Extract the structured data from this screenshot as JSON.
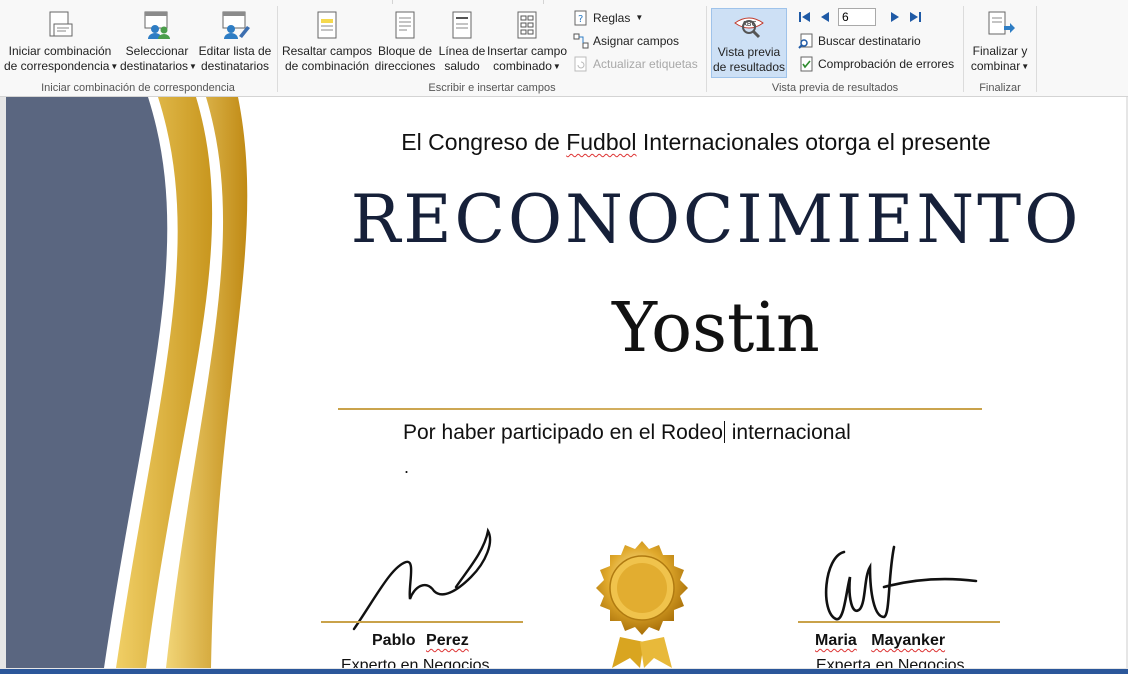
{
  "ribbon": {
    "groups": [
      {
        "label": "Iniciar combinación de correspondencia",
        "buttons": [
          {
            "line1": "Iniciar combinación",
            "line2": "de correspondencia",
            "icon": "start-merge-icon"
          },
          {
            "line1": "Seleccionar",
            "line2": "destinatarios",
            "icon": "select-recipients-icon"
          },
          {
            "line1": "Editar lista de",
            "line2": "destinatarios",
            "icon": "edit-recipients-icon"
          }
        ]
      },
      {
        "label": "Escribir e insertar campos",
        "buttons": [
          {
            "line1": "Resaltar campos",
            "line2": "de combinación",
            "icon": "highlight-fields-icon"
          },
          {
            "line1": "Bloque de",
            "line2": "direcciones",
            "icon": "address-block-icon"
          },
          {
            "line1": "Línea de",
            "line2": "saludo",
            "icon": "greeting-line-icon"
          },
          {
            "line1": "Insertar campo",
            "line2": "combinado",
            "icon": "insert-field-icon"
          }
        ],
        "small": [
          {
            "label": "Reglas",
            "icon": "rules-icon"
          },
          {
            "label": "Asignar campos",
            "icon": "match-fields-icon"
          },
          {
            "label": "Actualizar etiquetas",
            "icon": "update-labels-icon",
            "disabled": true
          }
        ]
      },
      {
        "label": "Vista previa de resultados",
        "buttons": [
          {
            "line1": "Vista previa",
            "line2": "de resultados",
            "icon": "preview-results-icon"
          }
        ],
        "record": "6",
        "small": [
          {
            "label": "Buscar destinatario",
            "icon": "find-recipient-icon"
          },
          {
            "label": "Comprobación de errores",
            "icon": "check-errors-icon"
          }
        ]
      },
      {
        "label": "Finalizar",
        "buttons": [
          {
            "line1": "Finalizar y",
            "line2": "combinar",
            "icon": "finish-merge-icon"
          }
        ]
      }
    ]
  },
  "certificate": {
    "issuer_before": "El Congreso de ",
    "issuer_misspelled": "Fudbol",
    "issuer_after": " Internacionales otorga el presente",
    "title": "RECONOCIMIENTO",
    "recipient": "Yostin",
    "reason_before": "Por haber participado en el Rodeo",
    "reason_after": " internacional",
    "dot": ".",
    "signers": [
      {
        "first": "Pablo",
        "last": "Perez",
        "role": "Experto  en  Negocios"
      },
      {
        "first": "Maria",
        "last": "Mayanker",
        "role": "Experta  en  Negocios"
      }
    ]
  },
  "colors": {
    "accent_gold": "#c9a24a",
    "slate": "#5a6680",
    "title_navy": "#162039",
    "ribbon_active": "#cde0f5",
    "taskbar": "#2b579a"
  }
}
